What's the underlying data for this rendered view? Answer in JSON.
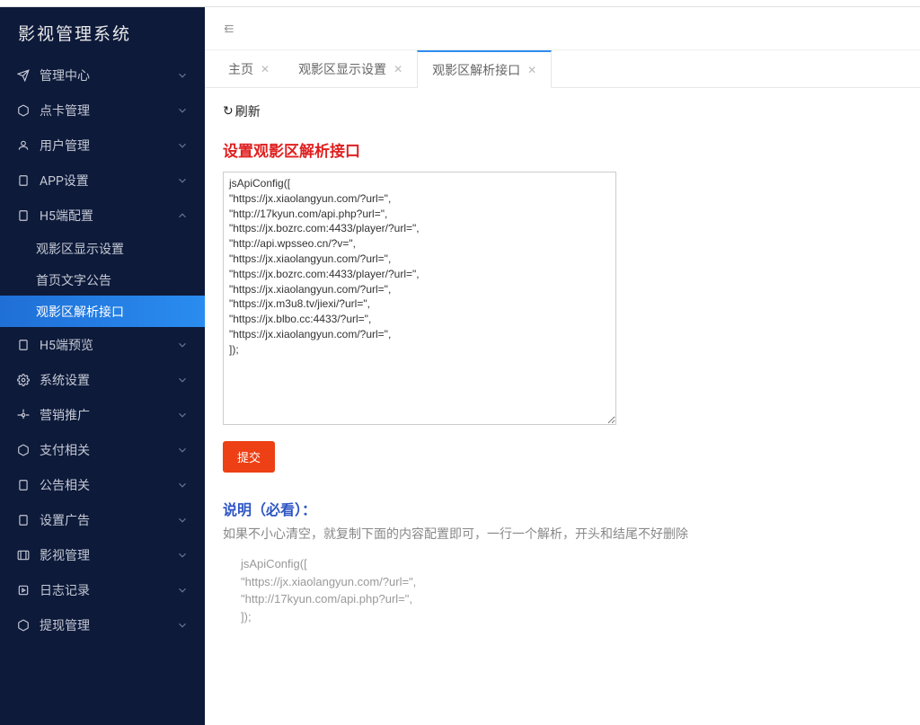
{
  "app": {
    "title": "影视管理系统"
  },
  "sidebar": {
    "items": [
      {
        "label": "管理中心",
        "icon": "paper-plane"
      },
      {
        "label": "点卡管理",
        "icon": "cube"
      },
      {
        "label": "用户管理",
        "icon": "user"
      },
      {
        "label": "APP设置",
        "icon": "tablet"
      },
      {
        "label": "H5端配置",
        "icon": "tablet",
        "expanded": true
      },
      {
        "label": "H5端预览",
        "icon": "tablet"
      },
      {
        "label": "系统设置",
        "icon": "gear"
      },
      {
        "label": "营销推广",
        "icon": "gear"
      },
      {
        "label": "支付相关",
        "icon": "cube"
      },
      {
        "label": "公告相关",
        "icon": "tablet"
      },
      {
        "label": "设置广告",
        "icon": "tablet"
      },
      {
        "label": "影视管理",
        "icon": "film"
      },
      {
        "label": "日志记录",
        "icon": "play"
      },
      {
        "label": "提现管理",
        "icon": "cube"
      }
    ],
    "submenu": [
      {
        "label": "观影区显示设置"
      },
      {
        "label": "首页文字公告"
      },
      {
        "label": "观影区解析接口"
      }
    ]
  },
  "tabs": [
    {
      "label": "主页"
    },
    {
      "label": "观影区显示设置"
    },
    {
      "label": "观影区解析接口"
    }
  ],
  "content": {
    "refresh": "刷新",
    "title": "设置观影区解析接口",
    "textarea_value": "jsApiConfig([\n\"https://jx.xiaolangyun.com/?url=\",\n\"http://17kyun.com/api.php?url=\",\n\"https://jx.bozrc.com:4433/player/?url=\",\n\"http://api.wpsseo.cn/?v=\",\n\"https://jx.xiaolangyun.com/?url=\",\n\"https://jx.bozrc.com:4433/player/?url=\",\n\"https://jx.xiaolangyun.com/?url=\",\n\"https://jx.m3u8.tv/jiexi/?url=\",\n\"https://jx.blbo.cc:4433/?url=\",\n\"https://jx.xiaolangyun.com/?url=\",\n]);",
    "submit": "提交",
    "note_title": "说明（必看）：",
    "note_text": "如果不小心清空，就复制下面的内容配置即可，一行一个解析，开头和结尾不好删除",
    "code_lines": [
      "jsApiConfig([",
      " \"https://jx.xiaolangyun.com/?url=\",",
      " \"http://17kyun.com/api.php?url=\",",
      "]);"
    ]
  }
}
